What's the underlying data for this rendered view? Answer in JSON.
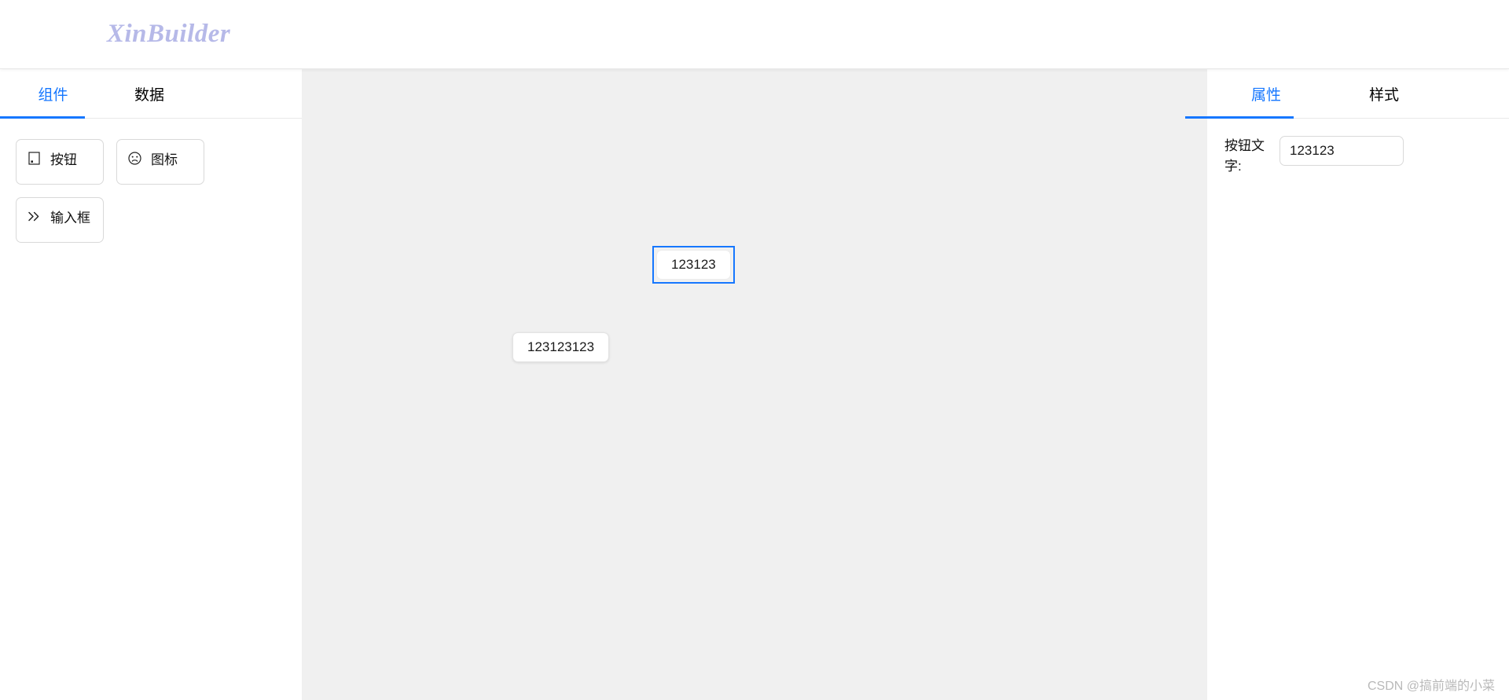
{
  "header": {
    "logo": "XinBuilder"
  },
  "left_panel": {
    "tabs": [
      {
        "label": "组件",
        "active": true
      },
      {
        "label": "数据",
        "active": false
      }
    ],
    "components": [
      {
        "label": "按钮",
        "icon": "button-rect-icon"
      },
      {
        "label": "图标",
        "icon": "sad-face-icon"
      },
      {
        "label": "输入框",
        "icon": "double-chevron-right-icon"
      }
    ]
  },
  "canvas": {
    "items": [
      {
        "label": "123123",
        "selected": true
      },
      {
        "label": "123123123",
        "selected": false
      }
    ]
  },
  "right_panel": {
    "tabs": [
      {
        "label": "属性",
        "active": true
      },
      {
        "label": "样式",
        "active": false
      }
    ],
    "properties": [
      {
        "label": "按钮文字:",
        "value": "123123",
        "placeholder": ""
      }
    ]
  },
  "watermark": "CSDN @搞前端的小菜",
  "colors": {
    "accent": "#1677ff",
    "logo": "#b6b9e8",
    "canvas_bg": "#f0f0f0",
    "panel_bg": "#ffffff",
    "border": "#d9d9d9",
    "watermark": "#b9b9b9"
  }
}
